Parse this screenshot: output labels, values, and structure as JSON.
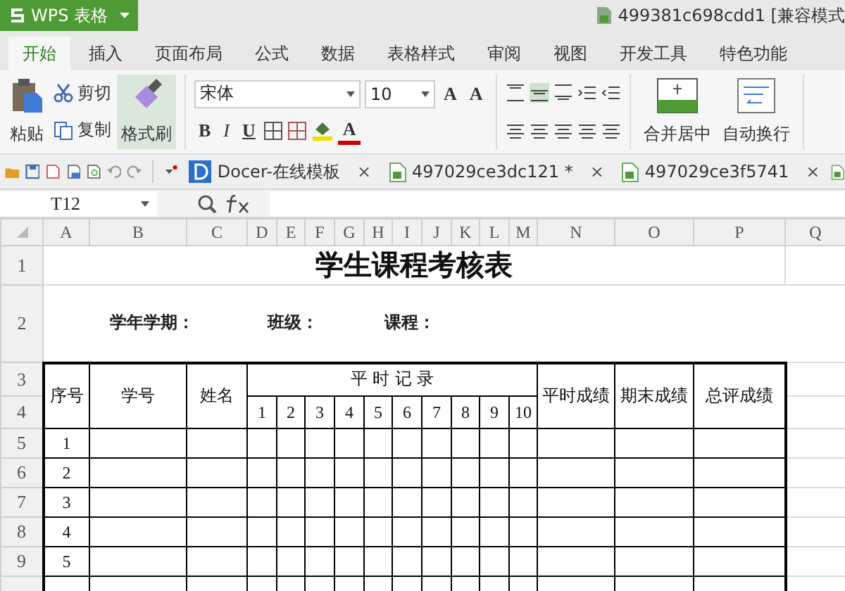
{
  "app_button": {
    "label": "WPS 表格"
  },
  "window": {
    "title": "499381c698cdd1 [兼容模式"
  },
  "tabs": [
    {
      "label": "开始",
      "selected": true
    },
    {
      "label": "插入",
      "selected": false
    },
    {
      "label": "页面布局",
      "selected": false
    },
    {
      "label": "公式",
      "selected": false
    },
    {
      "label": "数据",
      "selected": false
    },
    {
      "label": "表格样式",
      "selected": false
    },
    {
      "label": "审阅",
      "selected": false
    },
    {
      "label": "视图",
      "selected": false
    },
    {
      "label": "开发工具",
      "selected": false
    },
    {
      "label": "特色功能",
      "selected": false
    }
  ],
  "ribbon": {
    "paste": "粘贴",
    "cut": "剪切",
    "copy": "复制",
    "format_painter": {
      "label": "格式刷",
      "active": true
    },
    "font_name": "宋体",
    "font_size": "10",
    "grow_font": "A",
    "shrink_font": "A",
    "bold": "B",
    "italic": "I",
    "underline": "U",
    "font_color": "A",
    "vertical_align": [
      {
        "selected": false
      },
      {
        "selected": true
      },
      {
        "selected": false
      }
    ],
    "merge_center": "合并居中",
    "wrap_text": "自动换行"
  },
  "doc_tabs": [
    {
      "kind": "docer",
      "label": "Docer-在线模板",
      "close": "×"
    },
    {
      "kind": "sheet",
      "label": "497029ce3dc121 *",
      "close": "×"
    },
    {
      "kind": "sheet",
      "label": "497029ce3f5741",
      "close": "×"
    }
  ],
  "formula_bar": {
    "cell_ref": "T12"
  },
  "sheet": {
    "columns": [
      "A",
      "B",
      "C",
      "D",
      "E",
      "F",
      "G",
      "H",
      "I",
      "J",
      "K",
      "L",
      "M",
      "N",
      "O",
      "P",
      "Q"
    ],
    "row_numbers": [
      "1",
      "2",
      "3",
      "4",
      "5",
      "6",
      "7",
      "8",
      "9"
    ],
    "title": "学生课程考核表",
    "info_labels": [
      "学年学期：",
      "班级：",
      "课程："
    ],
    "headers": [
      "序号",
      "学号",
      "姓名"
    ],
    "group_header": "平 时 记 录",
    "sub_headers": [
      "1",
      "2",
      "3",
      "4",
      "5",
      "6",
      "7",
      "8",
      "9",
      "10"
    ],
    "score_headers": [
      "平时成绩",
      "期末成绩",
      "总评成绩"
    ],
    "rows": [
      "1",
      "2",
      "3",
      "4",
      "5"
    ]
  }
}
